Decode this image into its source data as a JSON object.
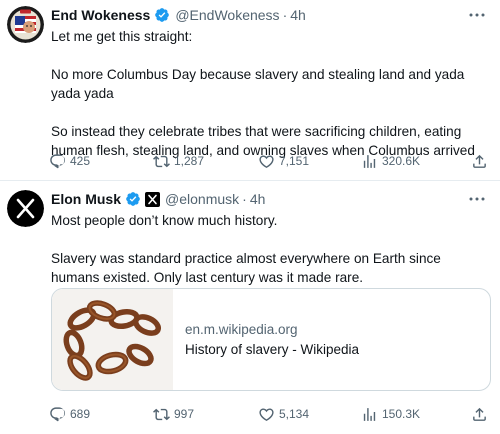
{
  "tweets": [
    {
      "author": {
        "name": "End Wokeness",
        "handle": "@EndWokeness",
        "verified": true
      },
      "separator": "·",
      "time": "4h",
      "paragraphs": [
        "Let me get this straight:",
        "No more Columbus Day because slavery and stealing land and yada yada yada",
        "So instead they celebrate tribes that were sacrificing children, eating human flesh, stealing land, and owning slaves when Columbus arrived"
      ],
      "stats": {
        "replies": "425",
        "retweets": "1,287",
        "likes": "7,151",
        "views": "320.6K"
      }
    },
    {
      "author": {
        "name": "Elon Musk",
        "handle": "@elonmusk",
        "verified": true,
        "affiliate_badge": "X"
      },
      "separator": "·",
      "time": "4h",
      "paragraphs": [
        "Most people don’t know much history.",
        "Slavery was standard practice almost everywhere on Earth since humans existed. Only last century was it made rare."
      ],
      "link_card": {
        "domain": "en.m.wikipedia.org",
        "title": "History of slavery - Wikipedia",
        "thumbnail": "rusty-chain-image"
      },
      "stats": {
        "replies": "689",
        "retweets": "997",
        "likes": "5,134",
        "views": "150.3K"
      }
    }
  ],
  "colors": {
    "verified": "#1d9bf0",
    "secondary_text": "#536471",
    "primary_text": "#0f1419",
    "border": "#cfd9de"
  },
  "icons": [
    "more-icon",
    "reply-icon",
    "retweet-icon",
    "like-icon",
    "views-icon",
    "share-icon",
    "verified-icon",
    "x-logo-icon"
  ]
}
